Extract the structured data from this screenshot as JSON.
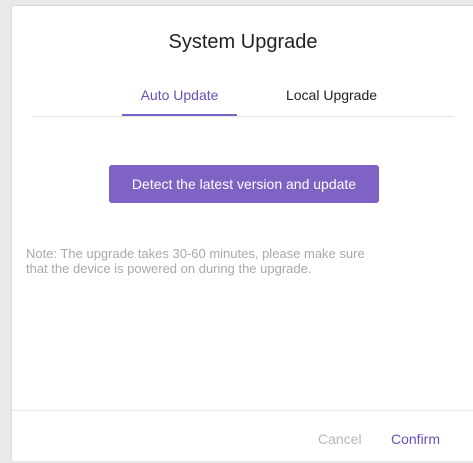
{
  "dialog": {
    "title": "System Upgrade",
    "tabs": [
      {
        "label": "Auto Update",
        "active": true
      },
      {
        "label": "Local Upgrade",
        "active": false
      }
    ],
    "detect_button_label": "Detect the latest version and update",
    "note_line1": "Note: The upgrade takes 30-60 minutes, please make sure",
    "note_line2": "that the device is powered on during the upgrade.",
    "cancel_label": "Cancel",
    "confirm_label": "Confirm"
  },
  "colors": {
    "accent": "#7e62c4",
    "accent_text": "#6a4fb8",
    "muted_text": "#a9a9a9",
    "disabled_text": "#b7b7b7"
  }
}
